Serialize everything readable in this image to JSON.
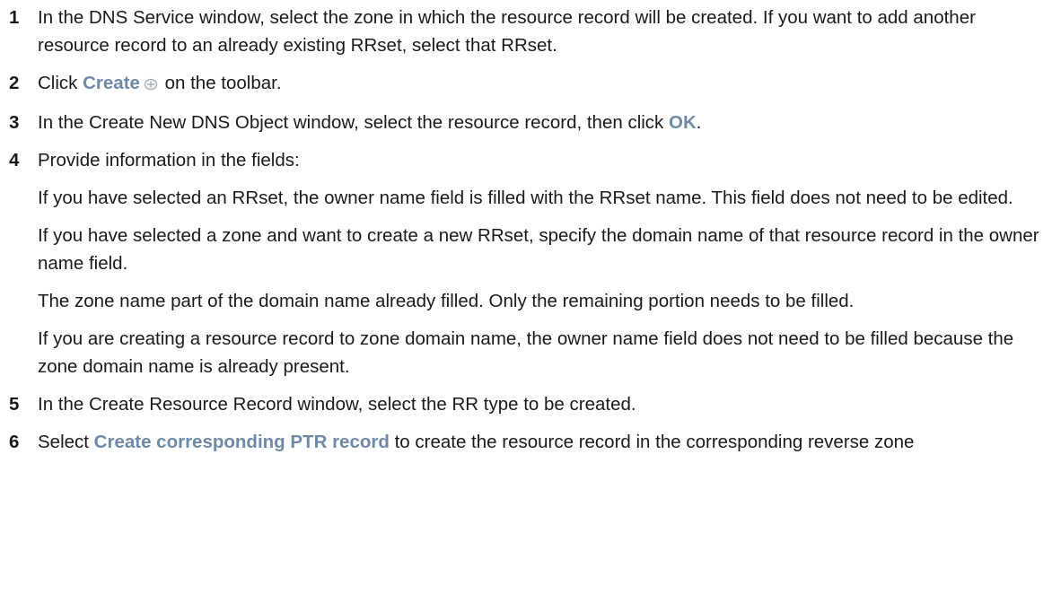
{
  "steps": [
    {
      "num": "1",
      "text": "In the DNS Service window, select the zone in which the resource record will be created. If you want to add another resource record to an already existing RRset, select that RRset."
    },
    {
      "num": "2",
      "pre": "Click ",
      "ui": "Create",
      "icon": "create-icon",
      "post": " on the toolbar."
    },
    {
      "num": "3",
      "pre": "In the Create New DNS Object window, select the resource record, then click ",
      "ui": "OK",
      "post": "."
    },
    {
      "num": "4",
      "text": "Provide information in the fields:",
      "paras": [
        "If you have selected an RRset, the owner name field is filled with the RRset name. This field does not need to be edited.",
        "If you have selected a zone and want to create a new RRset, specify the domain name of that resource record in the owner name field.",
        "The zone name part of the domain name already filled. Only the remaining portion needs to be filled.",
        "If you are creating a resource record to zone domain name, the owner name field does not need to be filled because the zone domain name is already present."
      ]
    },
    {
      "num": "5",
      "text": "In the Create Resource Record window, select the RR type to be created."
    },
    {
      "num": "6",
      "pre": "Select ",
      "ui": "Create corresponding PTR record",
      "post": " to create the resource record in the corresponding reverse zone"
    }
  ],
  "colors": {
    "ui_label": "#6f8aa6",
    "text": "#1a1a1a"
  }
}
